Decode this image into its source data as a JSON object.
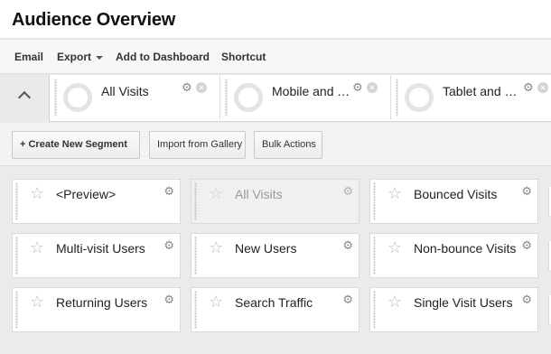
{
  "page": {
    "title": "Audience Overview"
  },
  "toolbar": {
    "email": "Email",
    "export": "Export",
    "add_to_dashboard": "Add to Dashboard",
    "shortcut": "Shortcut"
  },
  "selected_segments": [
    {
      "label": "All Visits"
    },
    {
      "label": "Mobile and Tab..."
    },
    {
      "label": "Tablet and Des..."
    }
  ],
  "actions": {
    "create_new_segment": "+ Create New Segment",
    "import_from_gallery": "Import from Gallery",
    "bulk_actions": "Bulk Actions"
  },
  "segment_list": [
    {
      "label": "<Preview>"
    },
    {
      "label": "All Visits",
      "disabled": true
    },
    {
      "label": "Bounced Visits"
    },
    {
      "label": "Multi-visit Users"
    },
    {
      "label": "New Users"
    },
    {
      "label": "Non-bounce Visits"
    },
    {
      "label": "Returning Users"
    },
    {
      "label": "Search Traffic"
    },
    {
      "label": "Single Visit Users"
    }
  ],
  "icons": {
    "gear": "gear-icon",
    "close": "close-icon",
    "star": "star-icon",
    "chevron_up": "chevron-up-icon",
    "caret_down": "caret-down-icon"
  }
}
